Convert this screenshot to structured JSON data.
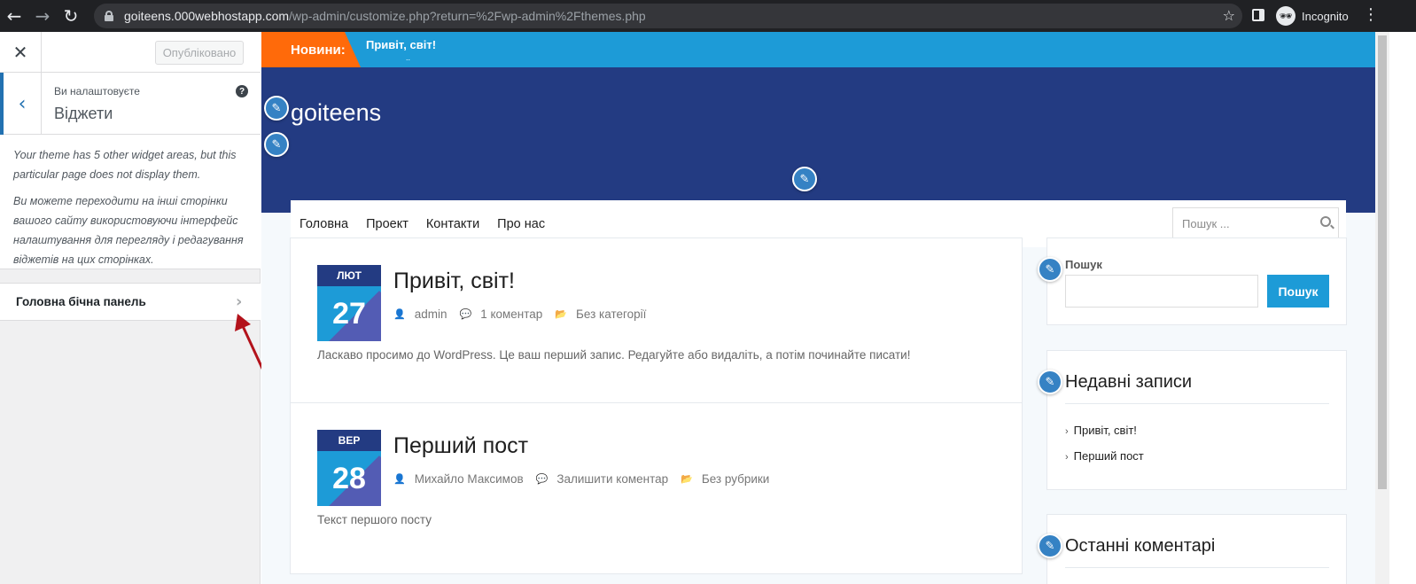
{
  "browser": {
    "url_host": "goiteens.000webhostapp.com",
    "url_path": "/wp-admin/customize.php?return=%2Fwp-admin%2Fthemes.php",
    "profile_label": "Incognito"
  },
  "customizer": {
    "publish_label": "Опубліковано",
    "section_subtitle": "Ви налаштовуєте",
    "section_title": "Віджети",
    "help": "?",
    "desc_1": "Your theme has 5 other widget areas, but this particular page does not display them.",
    "desc_2": "Ви можете переходити на інші сторінки вашого сайту використовуючи інтерфейс налаштування для перегляду і редагування віджетів на цих сторінках.",
    "item_label": "Головна бічна панель"
  },
  "site": {
    "news_label": "Новини:",
    "news_item": "Привіт, світ!",
    "news_dots": "..",
    "title": "goiteens",
    "menu": [
      "Головна",
      "Проект",
      "Контакти",
      "Про нас"
    ],
    "search_placeholder": "Пошук ..."
  },
  "posts": [
    {
      "month": "ЛЮТ",
      "day": "27",
      "title": "Привіт, світ!",
      "author": "admin",
      "comments": "1 коментар",
      "category": "Без категорії",
      "excerpt": "Ласкаво просимо до WordPress. Це ваш перший запис. Редагуйте або видаліть, а потім починайте писати!"
    },
    {
      "month": "ВЕР",
      "day": "28",
      "title": "Перший пост",
      "author": "Михайло Максимов",
      "comments": "Залишити коментар",
      "category": "Без рубрики",
      "excerpt": "Текст першого посту"
    }
  ],
  "sidebar": {
    "search_label": "Пошук",
    "search_button": "Пошук",
    "recent_title": "Недавні записи",
    "recent_items": [
      "Привіт, світ!",
      "Перший пост"
    ],
    "comments_title": "Останні коментарі"
  },
  "colors": {
    "news_bar": "#1d9bd7",
    "news_label": "#ff6a0a",
    "header": "#233b82",
    "accent": "#2271b1",
    "annotation_arrow": "#b3121b"
  }
}
